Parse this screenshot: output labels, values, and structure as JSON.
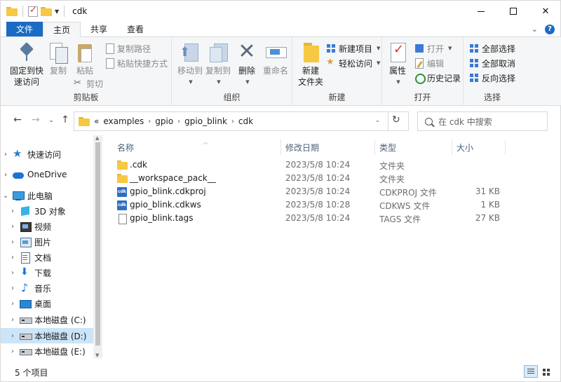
{
  "window": {
    "title": "cdk"
  },
  "tabs": [
    {
      "label": "文件"
    },
    {
      "label": "主页"
    },
    {
      "label": "共享"
    },
    {
      "label": "查看"
    }
  ],
  "ribbon": {
    "clipboard": {
      "label": "剪贴板",
      "pin": "固定到快\n速访问",
      "pin_l1": "固定到快",
      "pin_l2": "速访问",
      "copy": "复制",
      "paste": "粘贴",
      "copy_path": "复制路径",
      "paste_shortcut": "粘贴快捷方式",
      "cut": "剪切"
    },
    "organize": {
      "label": "组织",
      "move_to": "移动到",
      "copy_to": "复制到",
      "delete": "删除",
      "rename": "重命名"
    },
    "new": {
      "label": "新建",
      "new_folder_l1": "新建",
      "new_folder_l2": "文件夹",
      "new_item": "新建项目",
      "easy_access": "轻松访问"
    },
    "open": {
      "label": "打开",
      "properties": "属性",
      "open": "打开",
      "edit": "编辑",
      "history": "历史记录"
    },
    "select": {
      "label": "选择",
      "select_all": "全部选择",
      "select_none": "全部取消",
      "invert": "反向选择"
    }
  },
  "address": {
    "prefix": "«",
    "crumbs": [
      "examples",
      "gpio",
      "gpio_blink",
      "cdk"
    ],
    "search_placeholder": "在 cdk 中搜索"
  },
  "nav": {
    "items": [
      {
        "label": "快速访问",
        "icon": "star-icon"
      },
      {
        "label": "OneDrive",
        "icon": "cloud-icon"
      },
      {
        "label": "此电脑",
        "icon": "computer-icon"
      },
      {
        "label": "3D 对象",
        "icon": "cube-icon"
      },
      {
        "label": "视频",
        "icon": "video-icon"
      },
      {
        "label": "图片",
        "icon": "picture-icon"
      },
      {
        "label": "文档",
        "icon": "document-icon"
      },
      {
        "label": "下载",
        "icon": "download-icon"
      },
      {
        "label": "音乐",
        "icon": "music-icon"
      },
      {
        "label": "桌面",
        "icon": "desktop-icon"
      },
      {
        "label": "本地磁盘 (C:)",
        "icon": "drive-icon"
      },
      {
        "label": "本地磁盘 (D:)",
        "icon": "drive-icon"
      },
      {
        "label": "本地磁盘 (E:)",
        "icon": "drive-icon"
      }
    ]
  },
  "columns": {
    "name": "名称",
    "modified": "修改日期",
    "type": "类型",
    "size": "大小"
  },
  "files": [
    {
      "name": ".cdk",
      "modified": "2023/5/8 10:24",
      "type": "文件夹",
      "size": "",
      "icon": "folder-icon"
    },
    {
      "name": "__workspace_pack__",
      "modified": "2023/5/8 10:24",
      "type": "文件夹",
      "size": "",
      "icon": "folder-icon"
    },
    {
      "name": "gpio_blink.cdkproj",
      "modified": "2023/5/8 10:24",
      "type": "CDKPROJ 文件",
      "size": "31 KB",
      "icon": "cdk-file-icon"
    },
    {
      "name": "gpio_blink.cdkws",
      "modified": "2023/5/8 10:28",
      "type": "CDKWS 文件",
      "size": "1 KB",
      "icon": "cdk-file-icon"
    },
    {
      "name": "gpio_blink.tags",
      "modified": "2023/5/8 10:24",
      "type": "TAGS 文件",
      "size": "27 KB",
      "icon": "file-icon"
    }
  ],
  "status": {
    "count": "5 个项目"
  },
  "cdk_badge": "cdk"
}
